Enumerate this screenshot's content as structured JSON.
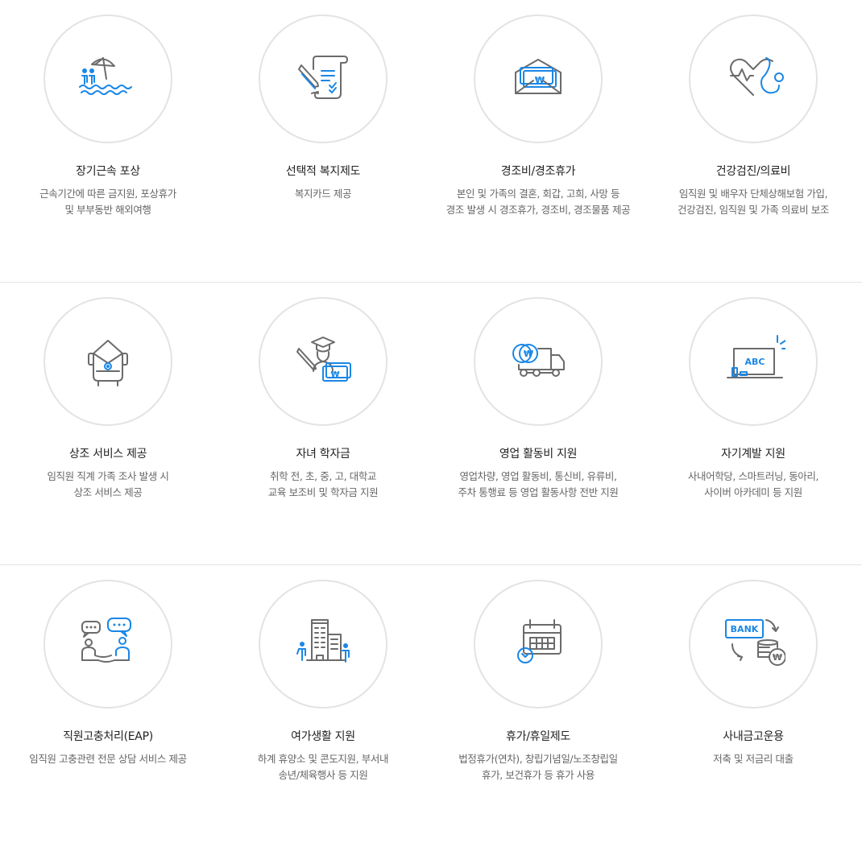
{
  "accent_color": "#1a87e6",
  "icon_color": "#6b6b6b",
  "benefits": [
    {
      "icon": "beach-umbrella-icon",
      "title": "장기근속 포상",
      "desc": [
        "근속기간에 따른 금지원, 포상휴가",
        "및 부부동반 해외여행"
      ]
    },
    {
      "icon": "contract-scroll-icon",
      "title": "선택적 복지제도",
      "desc": [
        "복지카드 제공",
        ""
      ]
    },
    {
      "icon": "money-envelope-icon",
      "title": "경조비/경조휴가",
      "desc": [
        "본인 및 가족의 결혼, 회갑, 고희, 사망 등",
        "경조 발생 시 경조휴가, 경조비, 경조물품 제공"
      ]
    },
    {
      "icon": "heart-stethoscope-icon",
      "title": "건강검진/의료비",
      "desc": [
        "임직원 및 배우자 단체상해보험 가입,",
        "건강검진, 임직원 및 가족 의료비 보조"
      ]
    },
    {
      "icon": "memorial-wreath-icon",
      "title": "상조 서비스 제공",
      "desc": [
        "임직원 직계 가족 조사 발생 시",
        "상조 서비스 제공"
      ]
    },
    {
      "icon": "graduate-scholarship-icon",
      "title": "자녀 학자금",
      "desc": [
        "취학 전, 초, 중, 고, 대학교",
        "교육 보조비 및 학자금 지원"
      ]
    },
    {
      "icon": "delivery-truck-icon",
      "title": "영업 활동비 지원",
      "desc": [
        "영업차량, 영업 활동비, 통신비, 유류비,",
        "주차 통행료 등 영업 활동사항 전반 지원"
      ]
    },
    {
      "icon": "laptop-abc-icon",
      "title": "자기계발 지원",
      "desc": [
        "사내어학당, 스마트러닝, 동아리,",
        "사이버 아카데미 등 지원"
      ]
    },
    {
      "icon": "chat-counseling-icon",
      "title": "직원고충처리(EAP)",
      "desc": [
        "임직원 고충관련 전문 상담 서비스 제공",
        ""
      ]
    },
    {
      "icon": "building-people-icon",
      "title": "여가생활 지원",
      "desc": [
        "하계 휴양소 및 콘도지원, 부서내",
        "송년/체육행사 등 지원"
      ]
    },
    {
      "icon": "calendar-icon",
      "title": "휴가/휴일제도",
      "desc": [
        "법정휴가(연차), 창립기념일/노조창립일",
        "휴가, 보건휴가 등 휴가 사용"
      ]
    },
    {
      "icon": "bank-coins-icon",
      "title": "사내금고운용",
      "desc": [
        "저축 및 저금리 대출",
        ""
      ]
    }
  ],
  "icon_text": {
    "won": "₩",
    "abc": "ABC",
    "bank": "BANK"
  }
}
